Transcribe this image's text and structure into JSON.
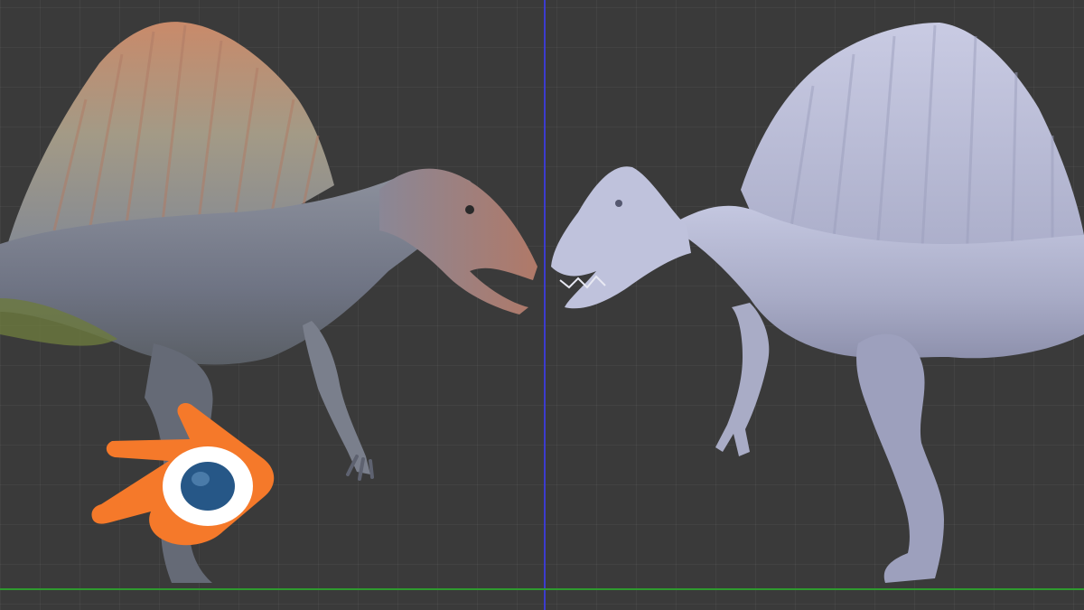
{
  "viewport": {
    "background": "#3a3a3a",
    "grid_color": "#444444"
  },
  "axes": {
    "z_axis_color": "#3c3ccf",
    "y_axis_color": "#2f9a2f"
  },
  "models": {
    "left": {
      "name": "spinosaurus-textured",
      "colors": {
        "sail": "#c98a6a",
        "body": "#7a7f8c",
        "belly": "#6d7a3e"
      }
    },
    "right": {
      "name": "spinosaurus-sculpt",
      "colors": {
        "body": "#b9bcd6",
        "shadow": "#8e91ad"
      }
    }
  },
  "logo": {
    "icon": "blender-logo-icon",
    "colors": {
      "orange": "#f5792a",
      "blue": "#265787",
      "white": "#ffffff"
    }
  }
}
